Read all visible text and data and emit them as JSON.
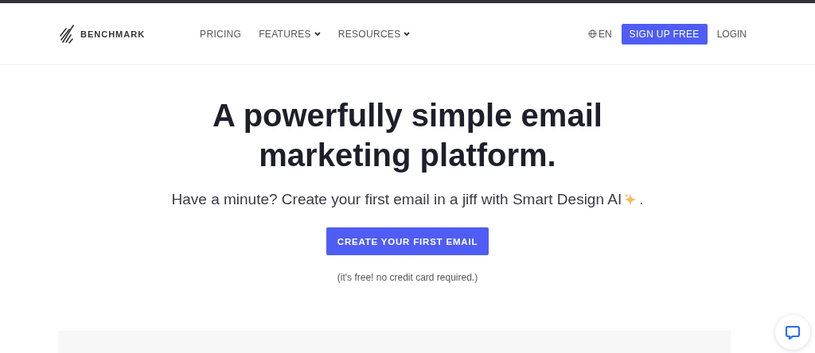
{
  "header": {
    "logo": "BENCHMARK",
    "nav": [
      {
        "label": "PRICING",
        "dropdown": false
      },
      {
        "label": "FEATURES",
        "dropdown": true
      },
      {
        "label": "RESOURCES",
        "dropdown": true
      }
    ],
    "language": "EN",
    "signup": "SIGN UP FREE",
    "login": "LOGIN"
  },
  "hero": {
    "headline": "A powerfully simple email marketing platform.",
    "subtitle": "Have a minute? Create your first email in a jiff with Smart Design AI",
    "subtitle_end": ".",
    "cta": "CREATE YOUR FIRST EMAIL",
    "note": "(it's free! no credit card required.)"
  }
}
